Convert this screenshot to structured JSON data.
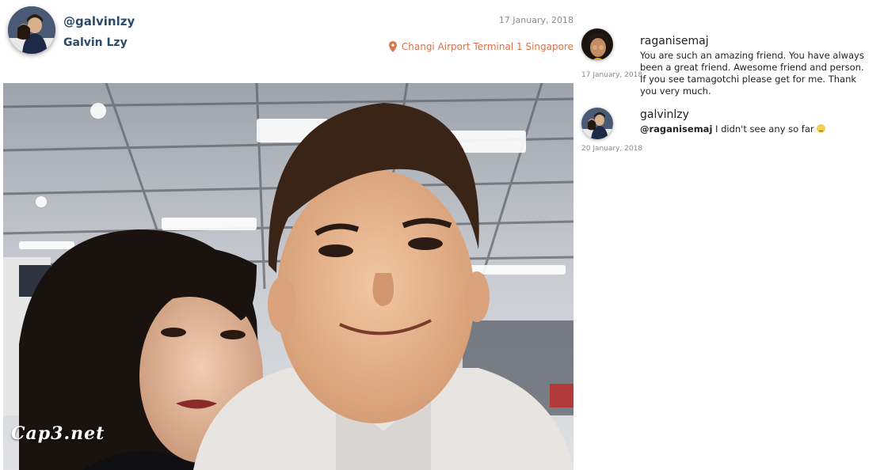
{
  "post": {
    "handle": "@galvinlzy",
    "full_name": "Galvin Lzy",
    "date": "17 January, 2018",
    "location": "Changi Airport Terminal 1 Singapore",
    "watermark": "Cap3.net",
    "location_icon": "map-pin-icon",
    "accent_color": "#d9734c"
  },
  "comments": [
    {
      "user": "raganisemaj",
      "date": "17 January, 2018",
      "text": "You are such an amazing friend. You have always been a great friend. Awesome friend and person. If you see tamagotchi please get for me. Thank you very much."
    },
    {
      "user": "galvinlzy",
      "date": "20 January, 2018",
      "mention": "@raganisemaj",
      "text": "I didn't see any so far",
      "emoji": "grimacing-face-emoji"
    }
  ]
}
